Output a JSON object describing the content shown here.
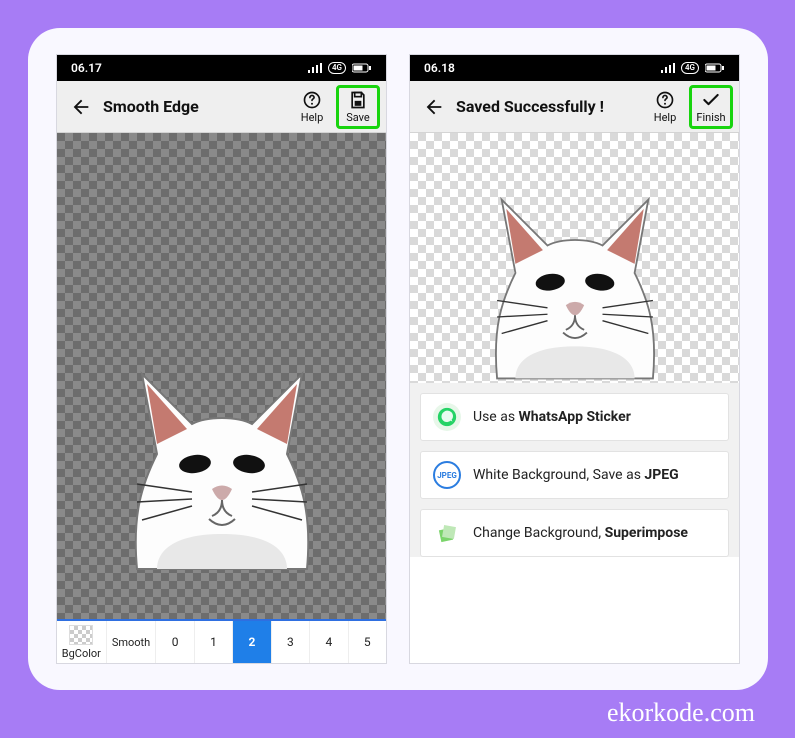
{
  "watermark": "ekorkode.com",
  "left": {
    "status_time": "06.17",
    "status_net": "4G",
    "title": "Smooth Edge",
    "help_label": "Help",
    "save_label": "Save",
    "bottom": {
      "bgcolor_label": "BgColor",
      "smooth_label": "Smooth",
      "values": [
        "0",
        "1",
        "2",
        "3",
        "4",
        "5"
      ],
      "active_index": 2
    }
  },
  "right": {
    "status_time": "06.18",
    "status_net": "4G",
    "title": "Saved Successfully !",
    "help_label": "Help",
    "finish_label": "Finish",
    "options": [
      {
        "label_plain": "Use as ",
        "label_bold": "WhatsApp Sticker",
        "icon": "whatsapp"
      },
      {
        "label_plain": "White Background, Save as ",
        "label_bold": "JPEG",
        "icon": "jpeg"
      },
      {
        "label_plain": "Change Background, ",
        "label_bold": "Superimpose",
        "icon": "layers"
      }
    ]
  }
}
